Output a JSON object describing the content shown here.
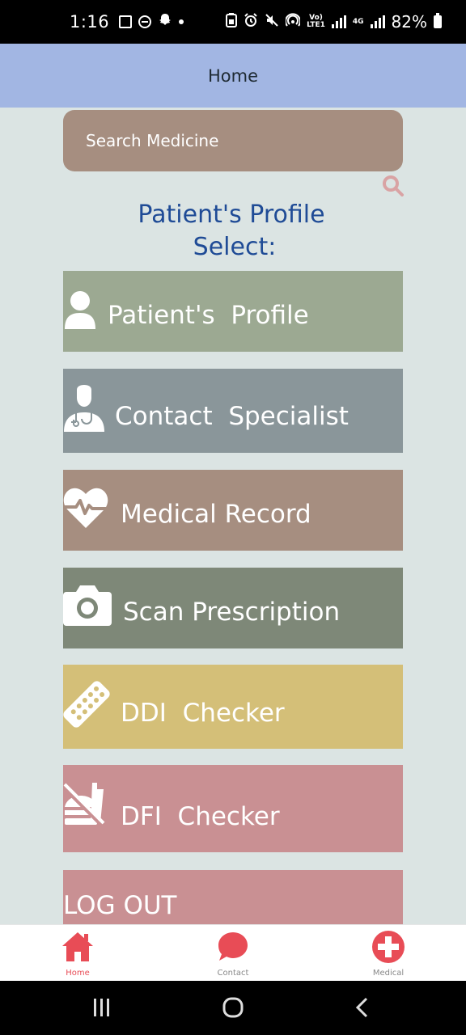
{
  "status_bar": {
    "time": "1:16",
    "network_volte": "Vo)",
    "network_lte": "LTE1",
    "network_4g": "4G",
    "battery": "82%"
  },
  "app_bar": {
    "title": "Home"
  },
  "search": {
    "placeholder": "Search Medicine"
  },
  "heading": {
    "line1": "Patient's Profile",
    "line2": "Select:"
  },
  "menu": {
    "profile": "Patient's  Profile",
    "contact": "Contact  Specialist",
    "medical": "Medical Record",
    "scan": "Scan Prescription",
    "ddi": "DDI  Checker",
    "dfi": "DFI  Checker",
    "logout": "LOG OUT"
  },
  "bottom_nav": {
    "home": "Home",
    "contact": "Contact",
    "medical": "Medical"
  },
  "colors": {
    "app_bar": "#a2b6e3",
    "background": "#dbe4e3",
    "heading": "#1f4b96",
    "accent": "#e84c56"
  }
}
